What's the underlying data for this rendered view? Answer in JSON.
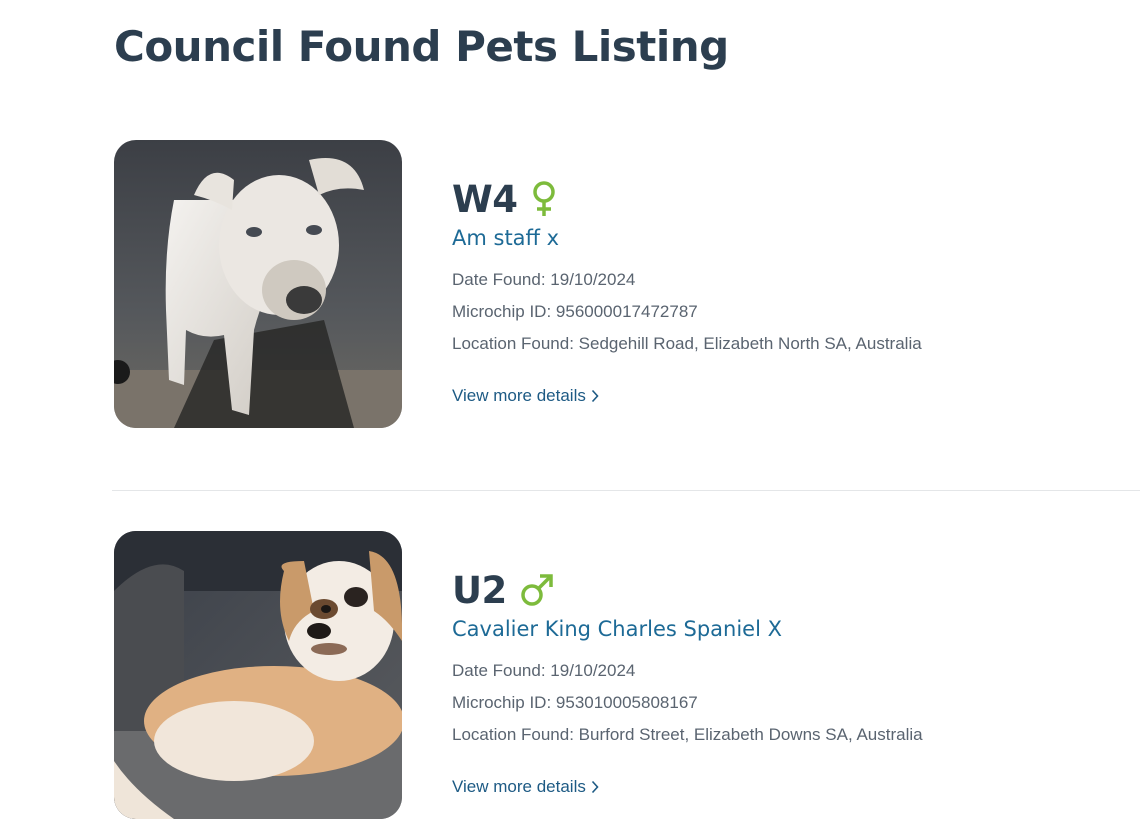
{
  "page": {
    "title": "Council Found Pets Listing"
  },
  "pets": [
    {
      "name": "W4",
      "sex_icon": "female-icon",
      "breed": "Am staff x",
      "date_found": "Date Found: 19/10/2024",
      "microchip": "Microchip ID: 956000017472787",
      "location": "Location Found: Sedgehill Road, Elizabeth North SA, Australia",
      "link_label": "View more details",
      "photo": "white dog photo"
    },
    {
      "name": "U2",
      "sex_icon": "male-icon",
      "breed": "Cavalier King Charles Spaniel X",
      "date_found": "Date Found: 19/10/2024",
      "microchip": "Microchip ID: 953010005808167",
      "location": "Location Found: Burford Street, Elizabeth Downs SA, Australia",
      "link_label": "View more details",
      "photo": "tan and white spaniel photo"
    }
  ],
  "colors": {
    "title": "#2c3e4f",
    "breed": "#1d6a96",
    "link": "#1d5a84",
    "sex_icon": "#7dbb3c",
    "detail_text": "#5a6470"
  }
}
